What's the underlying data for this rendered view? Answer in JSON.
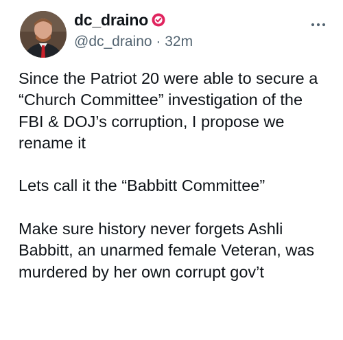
{
  "post": {
    "author": {
      "display_name": "dc_draino",
      "handle": "@dc_draino",
      "separator": "·",
      "time": "32m",
      "verified": true,
      "verified_color": "#e0245e"
    },
    "more_icon": "more-horizontal-icon",
    "paragraphs": [
      "Since the Patriot 20 were able to secure a “Church Committee” investigation of the FBI & DOJ’s corruption, I propose we rename it",
      "Lets call it the “Babbitt Committee”",
      "Make sure history never forgets Ashli Babbitt, an unarmed female Veteran, was murdered by her own corrupt gov’t"
    ]
  }
}
